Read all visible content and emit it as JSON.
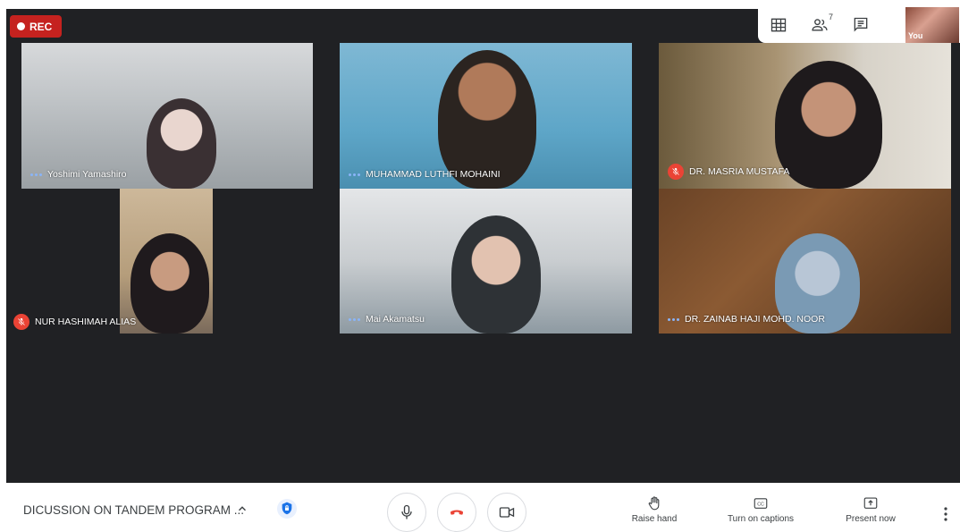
{
  "recording": {
    "label": "REC"
  },
  "top_bar": {
    "grid_icon": "grid-icon",
    "people_icon": "people-icon",
    "people_count": "7",
    "chat_icon": "chat-icon",
    "self_label": "You"
  },
  "participants": [
    {
      "name": "Yoshimi Yamashiro",
      "status": "speaking"
    },
    {
      "name": "MUHAMMAD LUTHFI MOHAINI",
      "status": "speaking"
    },
    {
      "name": "DR. MASRIA MUSTAFA",
      "status": "muted"
    },
    {
      "name": "NUR HASHIMAH ALIAS",
      "status": "muted"
    },
    {
      "name": "Mai Akamatsu",
      "status": "speaking"
    },
    {
      "name": "DR. ZAINAB HAJI MOHD. NOOR",
      "status": "speaking"
    }
  ],
  "bottom_bar": {
    "meeting_title": "DICUSSION ON TANDEM PROGRAM ...",
    "raise_hand_label": "Raise hand",
    "captions_label": "Turn on captions",
    "present_label": "Present now"
  },
  "colors": {
    "stage_bg": "#202124",
    "rec_red": "#c5221f",
    "mute_red": "#ea4335",
    "end_call_red": "#ea4335",
    "speaking_dots": "#8ab4f8"
  }
}
